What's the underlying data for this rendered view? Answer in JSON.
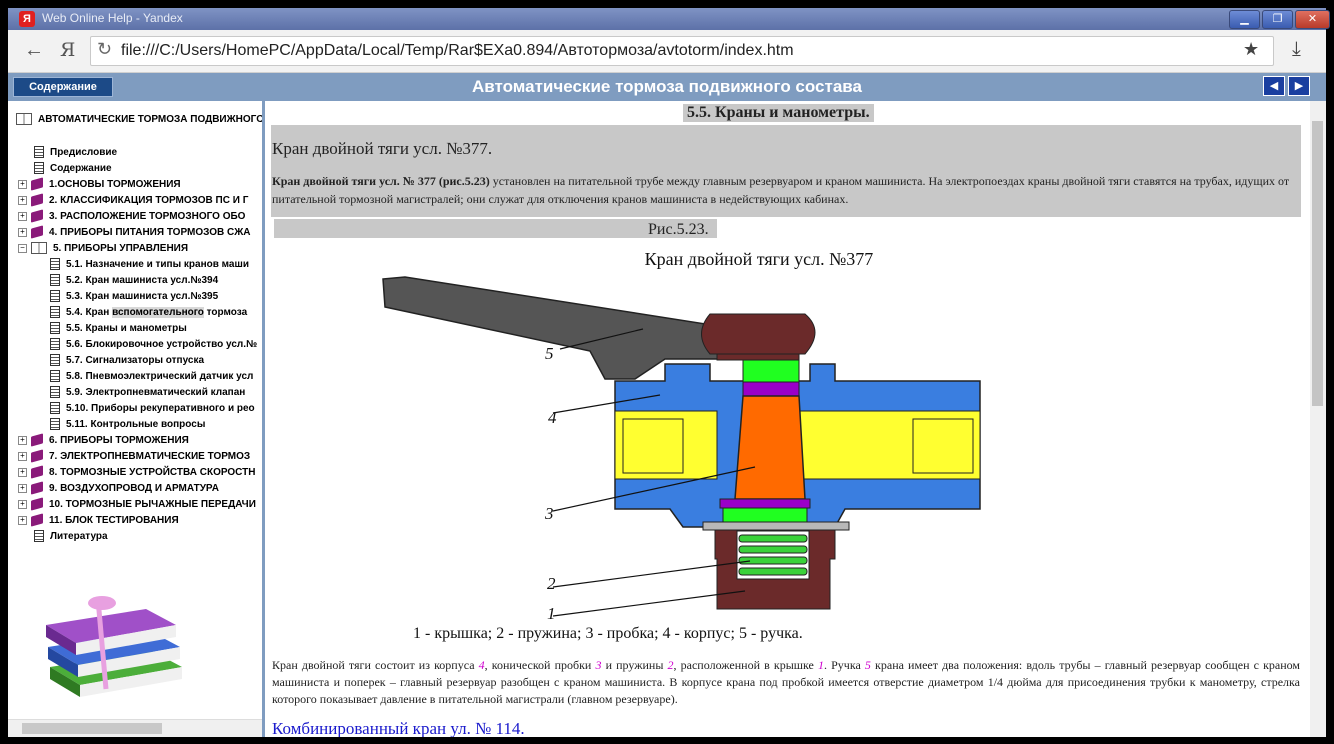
{
  "window": {
    "title": "Web Online Help - Yandex",
    "app_icon": "Я",
    "controls": {
      "minimize": "▁",
      "restore": "❐",
      "close": "✕"
    }
  },
  "browser": {
    "back_glyph": "←",
    "ya_glyph": "Я",
    "url": "file:///C:/Users/HomePC/AppData/Local/Temp/Rar$EXa0.894/Автотормоза/avtotorm/index.htm",
    "reload_glyph": "↻",
    "star_glyph": "★",
    "download_glyph": "⤓"
  },
  "header": {
    "toc_button": "Содержание",
    "title": "Автоматические тормоза подвижного состава",
    "prev_glyph": "◀",
    "next_glyph": "▶"
  },
  "tree": {
    "root": "АВТОМАТИЧЕСКИЕ ТОРМОЗА ПОДВИЖНОГО",
    "items": [
      {
        "label": "Предисловие",
        "icon": "doc"
      },
      {
        "label": "Содержание",
        "icon": "doc"
      },
      {
        "label": "1.ОСНОВЫ ТОРМОЖЕНИЯ",
        "icon": "book"
      },
      {
        "label": "2. КЛАССИФИКАЦИЯ ТОРМОЗОВ ПС И Г",
        "icon": "book"
      },
      {
        "label": "3. РАСПОЛОЖЕНИЕ ТОРМОЗНОГО ОБО",
        "icon": "book"
      },
      {
        "label": "4. ПРИБОРЫ ПИТАНИЯ ТОРМОЗОВ СЖА",
        "icon": "book"
      },
      {
        "label": "5. ПРИБОРЫ УПРАВЛЕНИЯ",
        "icon": "open-book"
      },
      {
        "label": "5.1. Назначение и типы кранов маши",
        "icon": "doc"
      },
      {
        "label": "5.2. Кран машиниста усл.№394",
        "icon": "doc"
      },
      {
        "label": "5.3. Кран машиниста усл.№395",
        "icon": "doc"
      },
      {
        "label": "5.4. Кран ",
        "label_highlight": "вспомогательного",
        "label_rest": " тормоза ",
        "icon": "doc"
      },
      {
        "label": "5.5. Краны и манометры",
        "icon": "doc"
      },
      {
        "label": "5.6. Блокировочное устройство усл.№",
        "icon": "doc"
      },
      {
        "label": "5.7. Сигнализаторы отпуска",
        "icon": "doc"
      },
      {
        "label": "5.8. Пневмоэлектрический датчик усл",
        "icon": "doc"
      },
      {
        "label": "5.9. Электропневматический клапан",
        "icon": "doc"
      },
      {
        "label": "5.10. Приборы рекуперативного и рео",
        "icon": "doc"
      },
      {
        "label": "5.11. Контрольные вопросы",
        "icon": "doc"
      },
      {
        "label": "6. ПРИБОРЫ ТОРМОЖЕНИЯ",
        "icon": "book"
      },
      {
        "label": "7. ЭЛЕКТРОПНЕВМАТИЧЕСКИЕ ТОРМОЗ",
        "icon": "book"
      },
      {
        "label": "8. ТОРМОЗНЫЕ УСТРОЙСТВА СКОРОСТН",
        "icon": "book"
      },
      {
        "label": "9. ВОЗДУХОПРОВОД И АРМАТУРА",
        "icon": "book"
      },
      {
        "label": "10. ТОРМОЗНЫЕ РЫЧАЖНЫЕ ПЕРЕДАЧИ",
        "icon": "book"
      },
      {
        "label": "11. БЛОК ТЕСТИРОВАНИЯ",
        "icon": "book"
      },
      {
        "label": "Литература",
        "icon": "doc"
      }
    ]
  },
  "content": {
    "section_heading": "5.5. Краны и манометры.",
    "crane_heading": "Кран двойной тяги усл. №377.",
    "intro_bold": "Кран двойной тяги усл. № 377 (рис.5.23)",
    "intro_text": " установлен на питательной трубе между главным резервуаром и краном машиниста. На электропоездах краны двойной тяги ставятся на трубах, идущих от питательной тормозной магистралей; они служат для отключения кранов машиниста в недействующих кабинах.",
    "figure_label": "Рис.5.23.",
    "figure_title": "Кран двойной тяги усл. №377",
    "callouts": [
      "5",
      "4",
      "3",
      "2",
      "1"
    ],
    "caption": "1 - крышка; 2 - пружина; 3 - пробка; 4 - корпус; 5 - ручка.",
    "body": {
      "t1": "Кран двойной тяги состоит из корпуса ",
      "n1": "4",
      "t2": ", конической пробки ",
      "n2": "3",
      "t3": " и пружины ",
      "n3": "2",
      "t4": ", расположенной в крышке ",
      "n4": "1",
      "t5": ". Ручка ",
      "n5": "5",
      "t6": " крана имеет два положения: вдоль трубы – главный резервуар сообщен с краном машиниста и поперек – главный резервуар разобщен с краном машиниста. В корпусе крана под пробкой имеется отверстие диаметром 1/4 дюйма для присоединения трубки к манометру, стрелка которого показывает давление в питательной магистрали (главном резервуаре)."
    },
    "next_heading": "Комбинированный кран ул. № 114."
  }
}
